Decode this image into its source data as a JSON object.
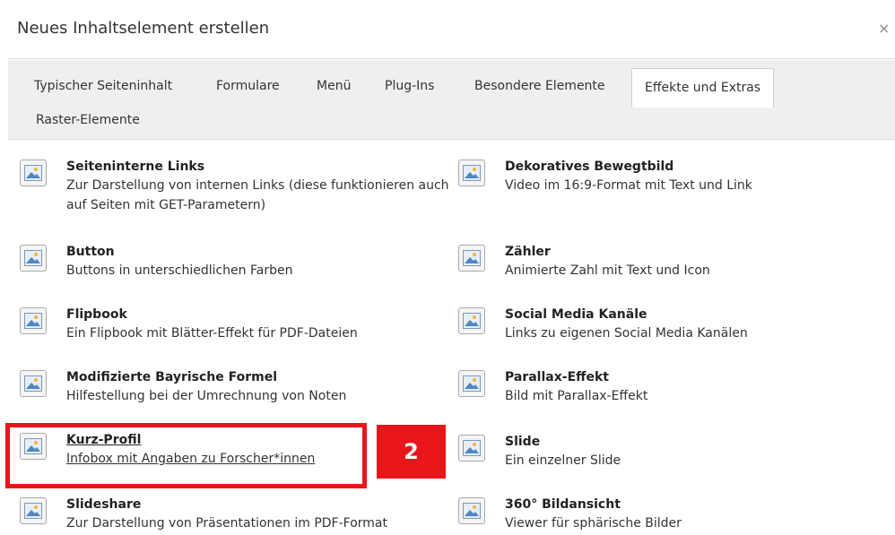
{
  "modal": {
    "title": "Neues Inhaltselement erstellen",
    "close_symbol": "×"
  },
  "tabs": [
    {
      "label": "Typischer Seiteninhalt",
      "active": false
    },
    {
      "label": "Formulare",
      "active": false
    },
    {
      "label": "Menü",
      "active": false
    },
    {
      "label": "Plug-Ins",
      "active": false
    },
    {
      "label": "Besondere Elemente",
      "active": false
    },
    {
      "label": "Effekte und Extras",
      "active": true
    },
    {
      "label": "Raster-Elemente",
      "active": false
    }
  ],
  "elements": [
    {
      "title": "Seiteninterne Links",
      "desc": "Zur Darstellung von internen Links (diese funktionieren auch auf Seiten mit GET-Parametern)",
      "icon": "image-icon"
    },
    {
      "title": "Dekoratives Bewegtbild",
      "desc": "Video im 16:9-Format mit Text und Link",
      "icon": "image-icon"
    },
    {
      "title": "Button",
      "desc": "Buttons in unterschiedlichen Farben",
      "icon": "image-icon"
    },
    {
      "title": "Zähler",
      "desc": "Animierte Zahl mit Text und Icon",
      "icon": "image-icon"
    },
    {
      "title": "Flipbook",
      "desc": "Ein Flipbook mit Blätter-Effekt für PDF-Dateien",
      "icon": "image-icon"
    },
    {
      "title": "Social Media Kanäle",
      "desc": "Links zu eigenen Social Media Kanälen",
      "icon": "image-icon"
    },
    {
      "title": "Modifizierte Bayrische Formel",
      "desc": "Hilfestellung bei der Umrechnung von Noten",
      "icon": "image-icon"
    },
    {
      "title": "Parallax-Effekt",
      "desc": "Bild mit Parallax-Effekt",
      "icon": "image-icon"
    },
    {
      "title": "Kurz-Profil ",
      "desc": "Infobox mit Angaben zu Forscher*innen",
      "icon": "image-icon",
      "hovered": true
    },
    {
      "title": "Slide",
      "desc": "Ein einzelner Slide",
      "icon": "image-icon"
    },
    {
      "title": "Slideshare",
      "desc": "Zur Darstellung von Präsentationen im PDF-Format",
      "icon": "image-icon"
    },
    {
      "title": "360° Bildansicht",
      "desc": "Viewer für sphärische Bilder",
      "icon": "image-icon"
    }
  ],
  "annotation": {
    "step_label": "2",
    "color": "#e8151b"
  }
}
